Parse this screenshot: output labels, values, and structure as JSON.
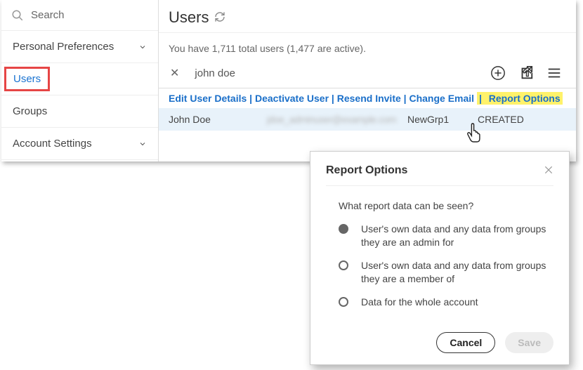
{
  "sidebar": {
    "search_label": "Search",
    "items": [
      {
        "label": "Personal Preferences",
        "has_chevron": true
      },
      {
        "label": "Users",
        "active": true
      },
      {
        "label": "Groups"
      },
      {
        "label": "Account Settings",
        "has_chevron": true
      }
    ]
  },
  "main": {
    "title": "Users",
    "subtext": "You have 1,711 total users (1,477 are active).",
    "filter_value": "john doe",
    "actions": {
      "edit": "Edit User Details",
      "deactivate": "Deactivate User",
      "resend": "Resend Invite",
      "change_email": "Change Email",
      "report_options": "Report Options"
    },
    "user_row": {
      "name": "John Doe",
      "email_blurred": "jdoe_adminuser@example.com",
      "group": "NewGrp1",
      "status": "CREATED"
    }
  },
  "dialog": {
    "title": "Report Options",
    "question": "What report data can be seen?",
    "options": [
      "User's own data and any data from groups they are an admin for",
      "User's own data and any data from groups they are a member of",
      "Data for the whole account"
    ],
    "cancel": "Cancel",
    "save": "Save"
  }
}
